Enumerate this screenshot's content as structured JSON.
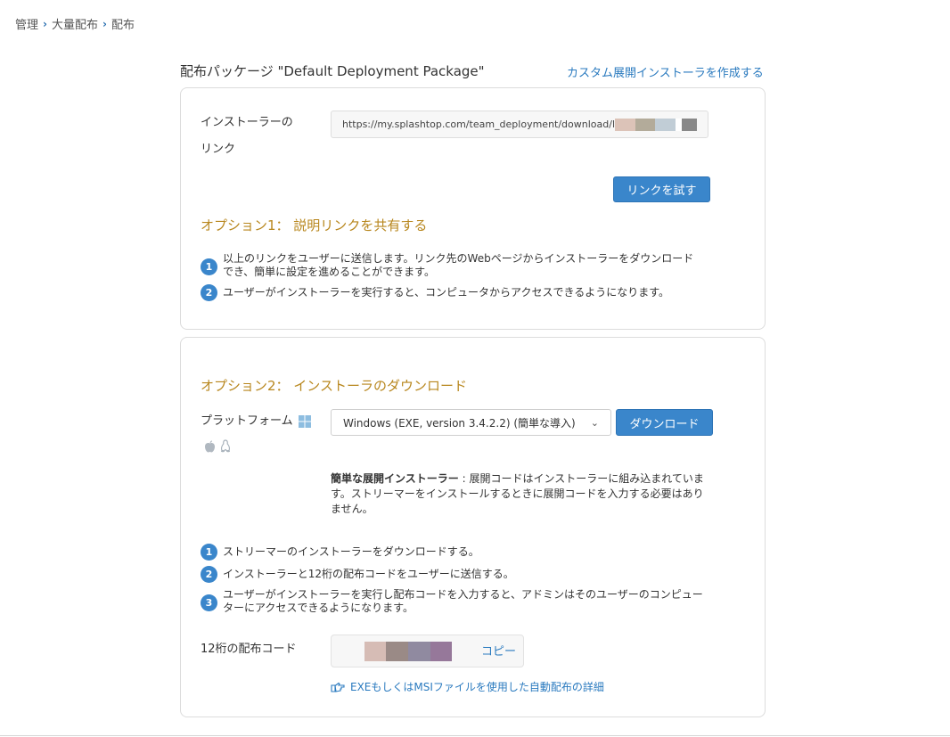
{
  "breadcrumb": {
    "items": [
      "管理",
      "大量配布",
      "配布"
    ]
  },
  "package": {
    "title": "配布パッケージ \"Default Deployment Package\"",
    "custom_installer_link": "カスタム展開インストーラを作成する"
  },
  "option1": {
    "installer_link_label_line1": "インストーラーの",
    "installer_link_label_line2": "リンク",
    "url": "https://my.splashtop.com/team_deployment/download/l",
    "test_link_button": "リンクを試す",
    "title": "オプション1： 説明リンクを共有する",
    "steps": [
      {
        "num": "1",
        "text": "以上のリンクをユーザーに送信します。リンク先のWebページからインストーラーをダウンロードでき、簡単に設定を進めることができます。"
      },
      {
        "num": "2",
        "text": "ユーザーがインストーラーを実行すると、コンピュータからアクセスできるようになります。"
      }
    ]
  },
  "option2": {
    "title": "オプション2： インストーラのダウンロード",
    "platform_label": "プラットフォーム",
    "platform_selected": "Windows (EXE, version 3.4.2.2) (簡単な導入)",
    "download_button": "ダウンロード",
    "desc_bold": "簡単な展開インストーラー",
    "desc_text": " : 展開コードはインストーラーに組み込まれています。ストリーマーをインストールするときに展開コードを入力する必要はありません。",
    "steps": [
      {
        "num": "1",
        "text": "ストリーマーのインストーラーをダウンロードする。"
      },
      {
        "num": "2",
        "text": "インストーラーと12桁の配布コードをユーザーに送信する。"
      },
      {
        "num": "3",
        "text": "ユーザーがインストーラーを実行し配布コードを入力すると、アドミンはそのユーザーのコンピューターにアクセスできるようになります。"
      }
    ],
    "code_label": "12桁の配布コード",
    "copy_link": "コピー",
    "detail_link": "EXEもしくはMSIファイルを使用した自動配布の詳細"
  },
  "icons": [
    "chevron-right-icon",
    "windows-icon",
    "apple-icon",
    "linux-icon",
    "chevron-down-icon",
    "hand-point-icon"
  ],
  "colors": {
    "accent_blue": "#3a86cb",
    "link_blue": "#2a7abf",
    "option_title": "#b8871e",
    "border": "#dcdcdc"
  }
}
